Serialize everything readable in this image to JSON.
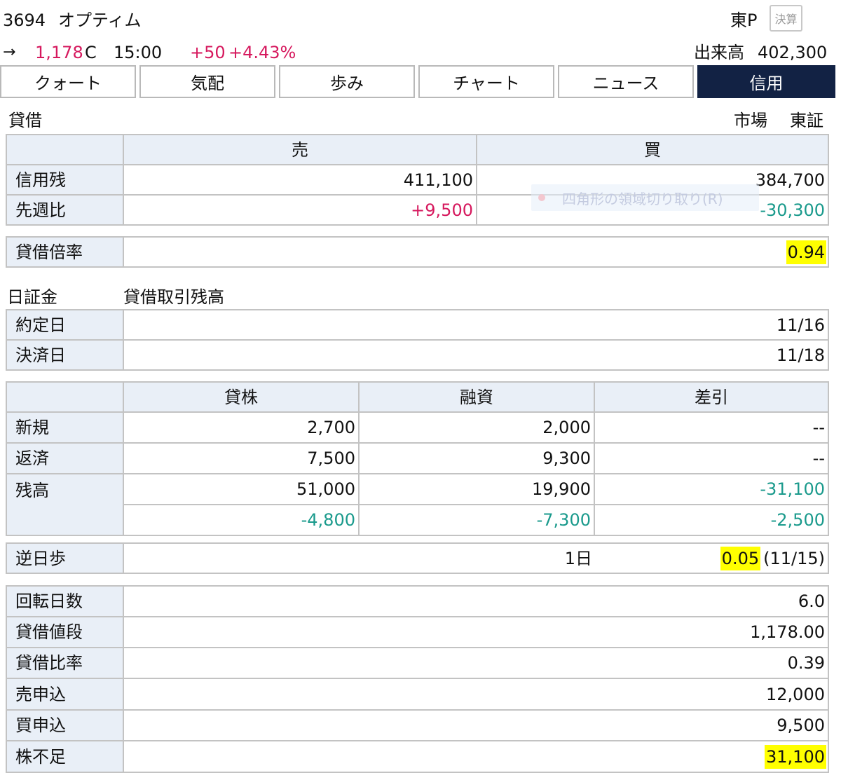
{
  "header": {
    "code": "3694",
    "name": "オプティム",
    "market_label": "東P",
    "kessan_label": "決算",
    "arrow": "→",
    "price": "1,178",
    "price_flag": "C",
    "time": "15:00",
    "change": "+50",
    "change_pct": "+4.43%",
    "volume_label": "出来高",
    "volume": "402,300"
  },
  "tabs": [
    "クォート",
    "気配",
    "歩み",
    "チャート",
    "ニュース",
    "信用"
  ],
  "active_tab": "信用",
  "colors": {
    "up": "#d6195e",
    "down": "#1a9a8c",
    "active_tab": "#122244",
    "label_bg": "#e9eff7",
    "highlight": "#ffff00"
  },
  "taishaku": {
    "title": "貸借",
    "market_label": "市場",
    "market_value": "東証",
    "col_sell": "売",
    "col_buy": "買",
    "rows": [
      {
        "label": "信用残",
        "sell": "411,100",
        "buy": "384,700"
      },
      {
        "label": "先週比",
        "sell": "+9,500",
        "buy": "-30,300"
      }
    ],
    "ratio_label": "貸借倍率",
    "ratio_value": "0.94"
  },
  "overlay_hint": "四角形の領域切り取り(R)",
  "nisshokin": {
    "title": "日証金",
    "subtitle": "貸借取引残高",
    "dates": [
      {
        "label": "約定日",
        "value": "11/16"
      },
      {
        "label": "決済日",
        "value": "11/18"
      }
    ],
    "columns": [
      "貸株",
      "融資",
      "差引"
    ],
    "rows": [
      {
        "label": "新規",
        "values": [
          "2,700",
          "2,000",
          "--"
        ]
      },
      {
        "label": "返済",
        "values": [
          "7,500",
          "9,300",
          "--"
        ]
      },
      {
        "label": "残高",
        "values": [
          "51,000",
          "19,900",
          "-31,100"
        ]
      }
    ],
    "diff_row": [
      "-4,800",
      "-7,300",
      "-2,500"
    ],
    "gyakuhibu": {
      "label": "逆日歩",
      "days": "1日",
      "value": "0.05",
      "date": "(11/15)"
    },
    "stats": [
      {
        "label": "回転日数",
        "value": "6.0"
      },
      {
        "label": "貸借値段",
        "value": "1,178.00"
      },
      {
        "label": "貸借比率",
        "value": "0.39"
      },
      {
        "label": "売申込",
        "value": "12,000"
      },
      {
        "label": "買申込",
        "value": "9,500"
      },
      {
        "label": "株不足",
        "value": "31,100"
      }
    ]
  }
}
